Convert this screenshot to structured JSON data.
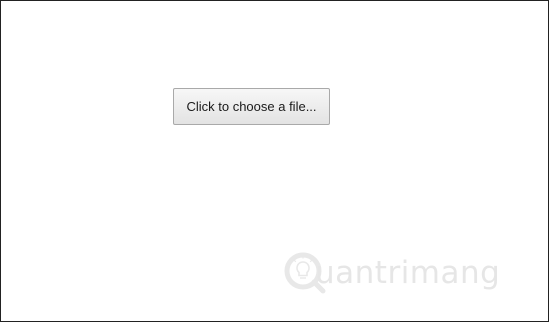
{
  "file_picker": {
    "button_label": "Click to choose a file..."
  },
  "watermark": {
    "text": "uantrimang",
    "logo_icon": "lightbulb-q-logo-icon",
    "color": "#e4e4e4"
  }
}
